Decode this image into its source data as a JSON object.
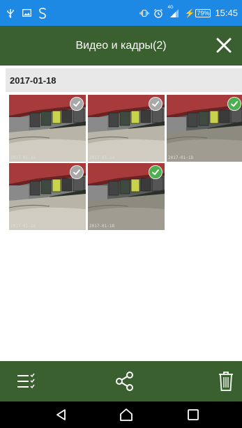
{
  "status_bar": {
    "time": "15:45",
    "battery": "79%",
    "network": "4G",
    "icons": [
      "usb-icon",
      "image-icon",
      "s-app-icon",
      "vibrate-icon",
      "alarm-icon",
      "signal-icon",
      "charging-icon"
    ]
  },
  "toolbar": {
    "title": "Видео и кадры(2)",
    "close_icon": "close-icon"
  },
  "gallery": {
    "date": "2017-01-18",
    "items": [
      {
        "timestamp": "2017-01-18",
        "selected": false
      },
      {
        "timestamp": "2017-01-18",
        "selected": false
      },
      {
        "timestamp": "2017-01-18",
        "selected": true
      },
      {
        "timestamp": "2017-01-18",
        "selected": false
      },
      {
        "timestamp": "2017-01-18",
        "selected": true
      }
    ]
  },
  "bottom_bar": {
    "actions": [
      "select-list-icon",
      "share-icon",
      "trash-icon"
    ]
  },
  "nav_bar": {
    "buttons": [
      "back-icon",
      "home-icon",
      "recents-icon"
    ]
  },
  "colors": {
    "status_bar": "#1e88e5",
    "toolbar": "#3a6030",
    "selected_check": "#4caf50",
    "unselected_check": "#a8a8a8"
  }
}
